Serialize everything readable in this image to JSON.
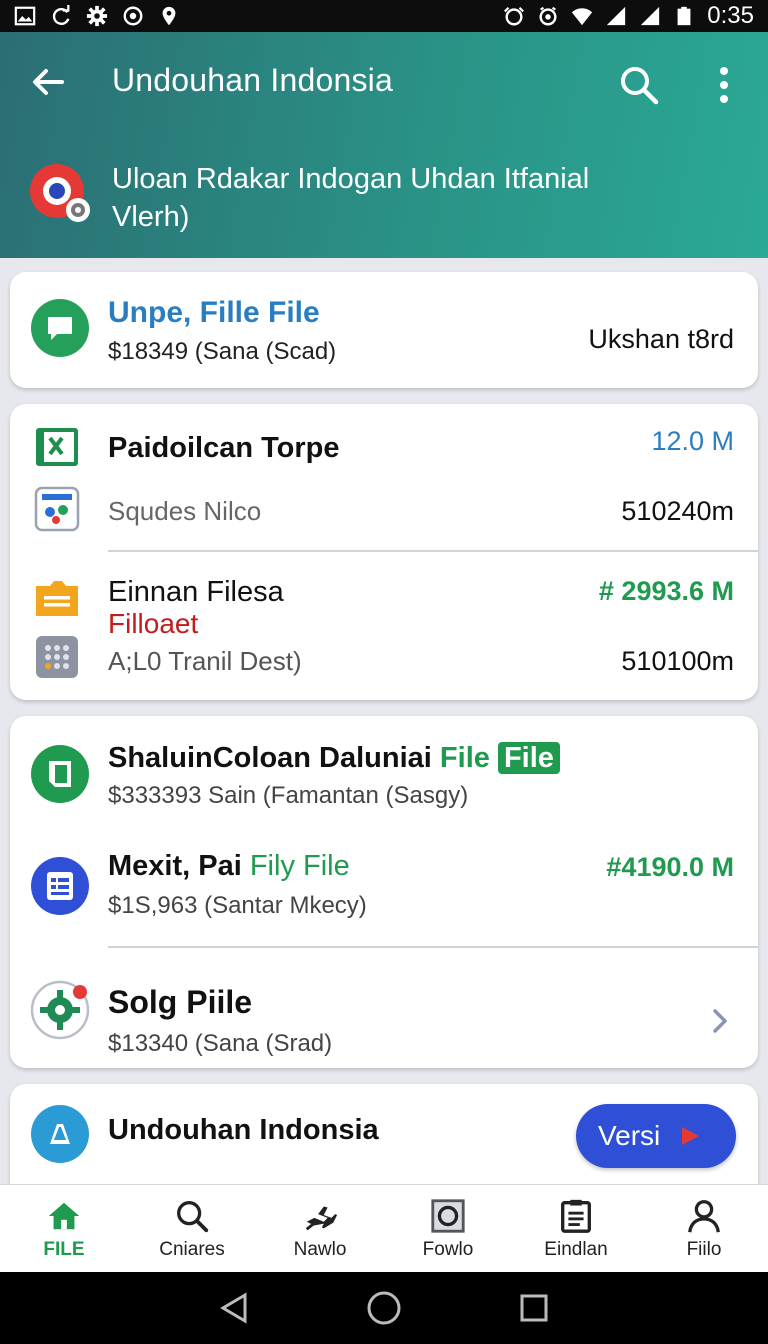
{
  "status_bar": {
    "time": "0:35"
  },
  "header": {
    "title": "Undouhan Indonsia",
    "subtitle_line1": "Uloan Rdakar Indogan Uhdan Itfanial",
    "subtitle_line2": "Vlerh)"
  },
  "card1": {
    "name": "Unpe, Fille File",
    "meta": "$18349 (Sana  (Scad)",
    "value": "Ukshan t8rd"
  },
  "card2": {
    "rows": [
      {
        "name": "Paidoilcan Torpe",
        "value": "12.0 M"
      },
      {
        "name": "Squdes Nilco",
        "value": "510240m"
      },
      {
        "name": "Einnan Filesa",
        "tag": "Filloaet",
        "value": "# 2993.6 M"
      },
      {
        "name": "A;L0 Tranil Dest)",
        "value": "510100m"
      }
    ]
  },
  "card3": {
    "rows": [
      {
        "name": "ShaluinColoan Daluniai",
        "name_green": "File",
        "badge": "File",
        "meta": "$333393 Sain  (Famantan (Sasgy)"
      },
      {
        "name": "Mexit, Pai",
        "name_green": "Fily File",
        "meta": "$1S,963 (Santar Mkecy)",
        "value": "#4190.0 M"
      },
      {
        "name": "Solg Piile",
        "meta": "$13340 (Sana  (Srad)"
      }
    ]
  },
  "card4": {
    "name": "Undouhan Indonsia",
    "button_label": "Versi"
  },
  "bottom_nav": [
    {
      "label": "FILE",
      "icon": "home-icon"
    },
    {
      "label": "Cniares",
      "icon": "search-icon"
    },
    {
      "label": "Nawlo",
      "icon": "plane-icon"
    },
    {
      "label": "Fowlo",
      "icon": "square-ring-icon"
    },
    {
      "label": "Eindlan",
      "icon": "clipboard-icon"
    },
    {
      "label": "Fiilo",
      "icon": "person-icon"
    }
  ],
  "colors": {
    "header_start": "#2b6e74",
    "header_end": "#2aa996",
    "accent_blue": "#2a7ec0",
    "accent_green": "#1f9a4f",
    "accent_red": "#c21c1c",
    "button_blue": "#2f4fd6"
  }
}
